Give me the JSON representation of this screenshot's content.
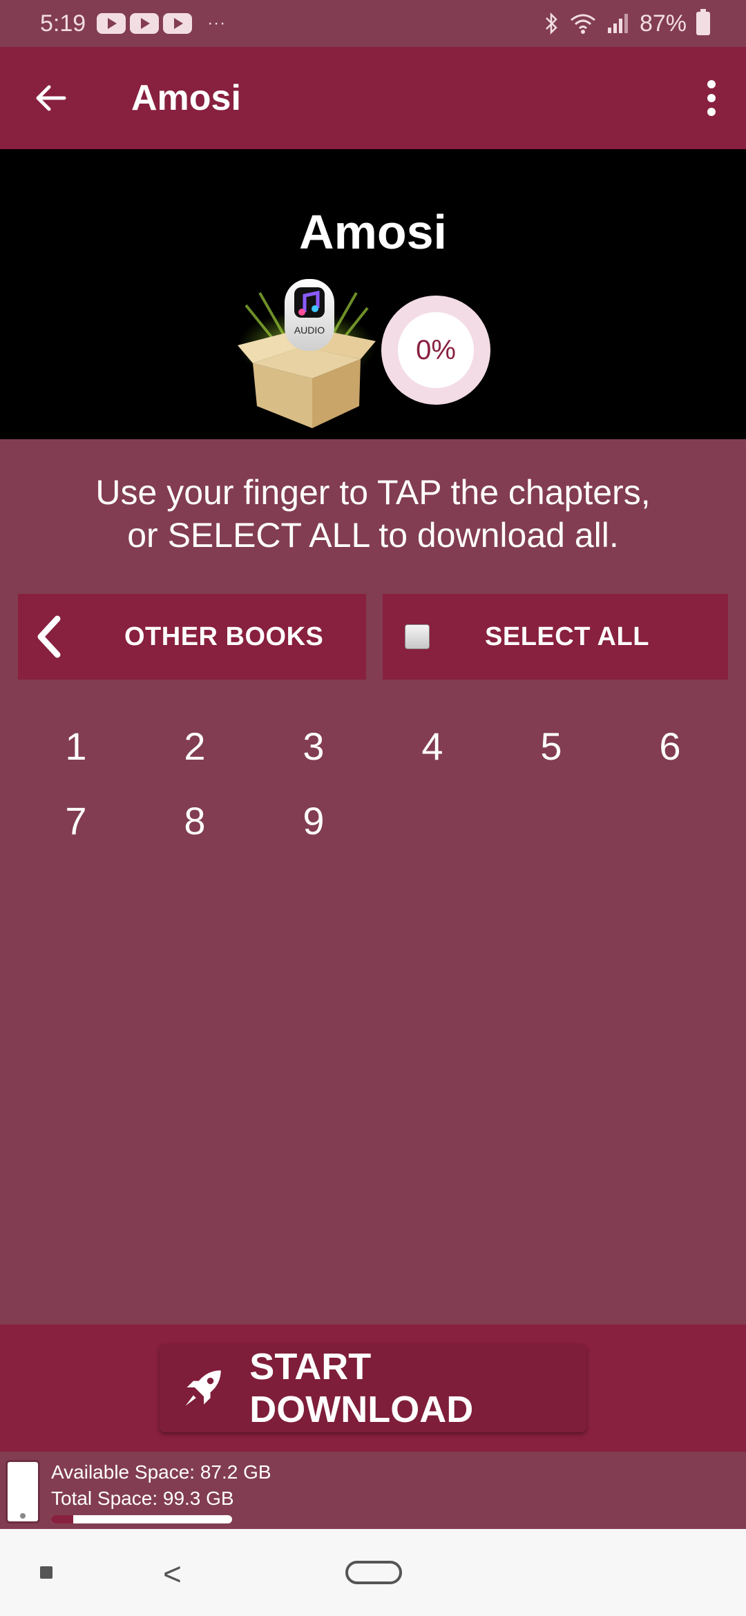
{
  "status": {
    "time": "5:19",
    "notification_icons": [
      "youtube-icon",
      "youtube-icon",
      "youtube-icon"
    ],
    "overflow": "···",
    "battery": "87%"
  },
  "app_bar": {
    "title": "Amosi"
  },
  "banner": {
    "title": "Amosi",
    "badge_text": "AUDIO",
    "progress": "0%"
  },
  "instructions": {
    "line1": "Use your finger to TAP the chapters,",
    "line2": "or SELECT ALL to download all."
  },
  "buttons": {
    "other_books": "OTHER BOOKS",
    "select_all": "SELECT ALL"
  },
  "chapters": [
    "1",
    "2",
    "3",
    "4",
    "5",
    "6",
    "7",
    "8",
    "9"
  ],
  "download": {
    "label": "START DOWNLOAD"
  },
  "storage": {
    "available": "Available Space: 87.2 GB",
    "total": "Total Space: 99.3 GB",
    "used_fraction": 0.122
  },
  "colors": {
    "primary": "#88203F",
    "background": "#823D52",
    "banner": "#000000"
  }
}
